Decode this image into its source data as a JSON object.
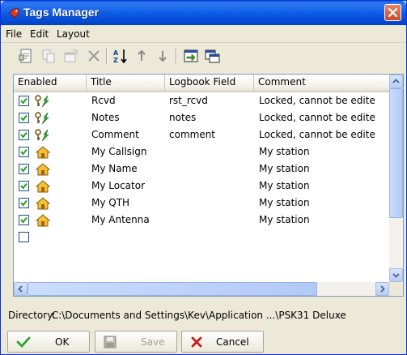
{
  "window": {
    "title": "Tags Manager"
  },
  "menu": {
    "file": "File",
    "edit": "Edit",
    "layout": "Layout"
  },
  "toolbar": {
    "icons": [
      "new-tag-icon",
      "copy-tag-icon",
      "edit-tag-icon",
      "delete-icon",
      "sort-az-icon",
      "move-up-icon",
      "move-down-icon",
      "load-icon",
      "save-as-icon"
    ]
  },
  "columns": {
    "enabled": "Enabled",
    "title": "Title",
    "logbook_field": "Logbook Field",
    "comment": "Comment"
  },
  "rows": [
    {
      "enabled": true,
      "icon": "locked-tag-icon",
      "title": "Rcvd",
      "logbook_field": "rst_rcvd",
      "comment": "Locked, cannot be edite"
    },
    {
      "enabled": true,
      "icon": "locked-tag-icon",
      "title": "Notes",
      "logbook_field": "notes",
      "comment": "Locked, cannot be edite"
    },
    {
      "enabled": true,
      "icon": "locked-tag-icon",
      "title": "Comment",
      "logbook_field": "comment",
      "comment": "Locked, cannot be edite"
    },
    {
      "enabled": true,
      "icon": "station-icon",
      "title": "My Callsign",
      "logbook_field": "",
      "comment": "My station"
    },
    {
      "enabled": true,
      "icon": "station-icon",
      "title": "My Name",
      "logbook_field": "",
      "comment": "My station"
    },
    {
      "enabled": true,
      "icon": "station-icon",
      "title": "My Locator",
      "logbook_field": "",
      "comment": "My station"
    },
    {
      "enabled": true,
      "icon": "station-icon",
      "title": "My QTH",
      "logbook_field": "",
      "comment": "My station"
    },
    {
      "enabled": true,
      "icon": "station-icon",
      "title": "My Antenna",
      "logbook_field": "",
      "comment": "My station"
    }
  ],
  "directory": {
    "label": "Directory:",
    "path": "C:\\Documents and Settings\\Kev\\Application ...\\PSK31 Deluxe"
  },
  "buttons": {
    "ok": "OK",
    "save": "Save",
    "cancel": "Cancel"
  },
  "colors": {
    "titlebar": "#0d5ae4",
    "selection_border": "#0831d9",
    "scroll": "#b7cdf7"
  }
}
